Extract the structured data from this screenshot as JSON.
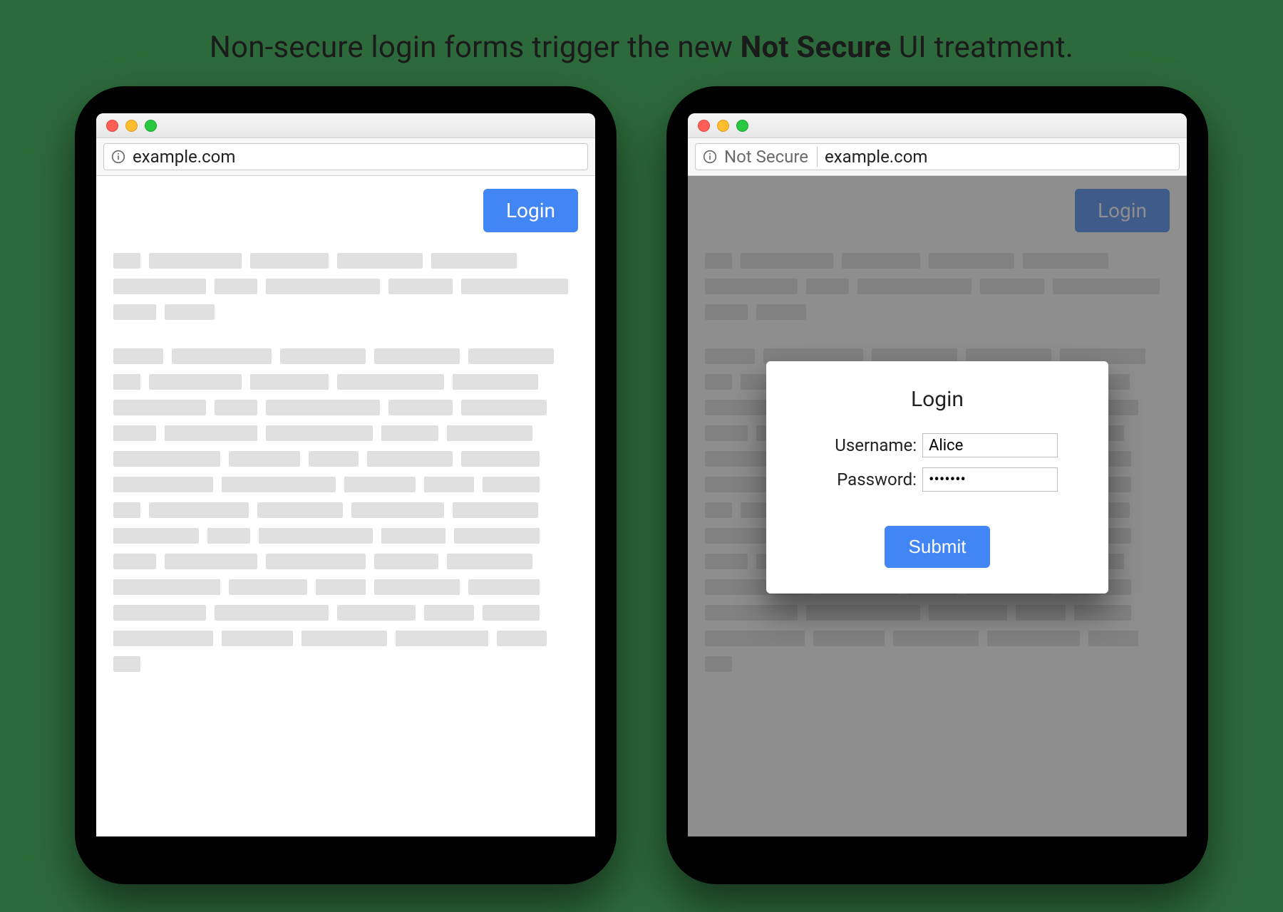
{
  "caption": {
    "prefix": "Non-secure login forms trigger the new ",
    "bold": "Not Secure",
    "suffix": " UI treatment."
  },
  "left": {
    "address": {
      "url": "example.com"
    },
    "login_button": "Login"
  },
  "right": {
    "address": {
      "not_secure_label": "Not Secure",
      "url": "example.com"
    },
    "login_button": "Login",
    "modal": {
      "title": "Login",
      "username_label": "Username:",
      "username_value": "Alice",
      "password_label": "Password:",
      "password_value": "•••••••",
      "submit_label": "Submit"
    }
  }
}
